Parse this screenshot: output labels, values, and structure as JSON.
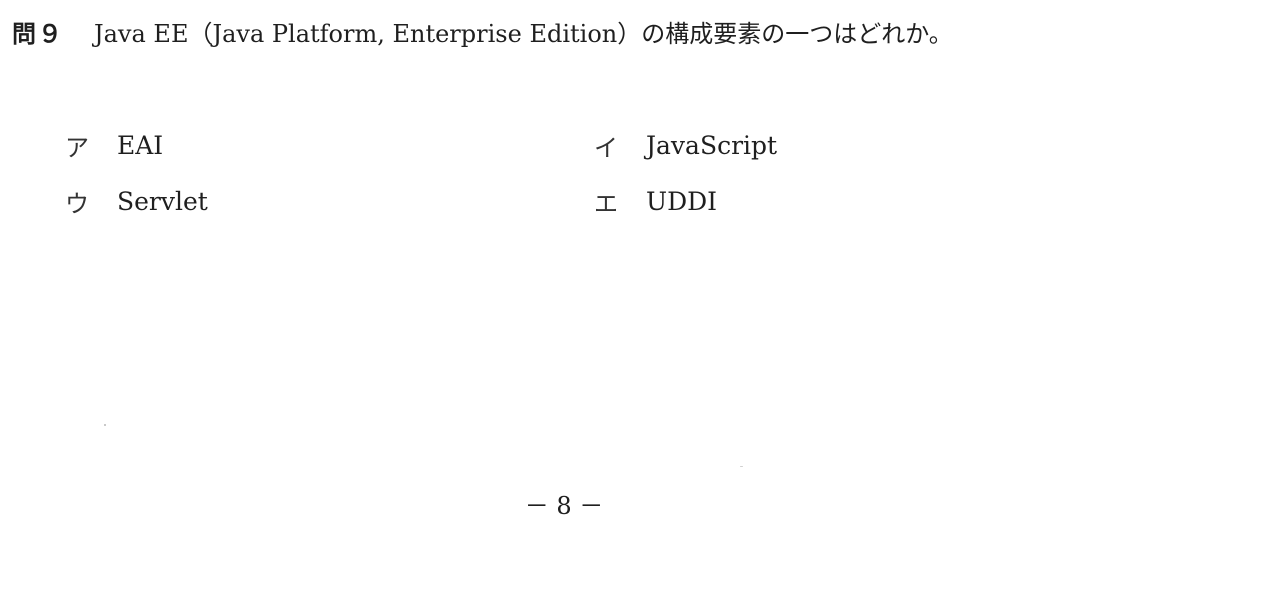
{
  "question": {
    "number": "問９",
    "text": "Java EE（Java Platform, Enterprise Edition）の構成要素の一つはどれか。"
  },
  "choices": [
    {
      "label": "ア",
      "text": "EAI"
    },
    {
      "label": "イ",
      "text": "JavaScript"
    },
    {
      "label": "ウ",
      "text": "Servlet"
    },
    {
      "label": "エ",
      "text": "UDDI"
    }
  ],
  "footer": {
    "page_number": "－ 8 －"
  }
}
